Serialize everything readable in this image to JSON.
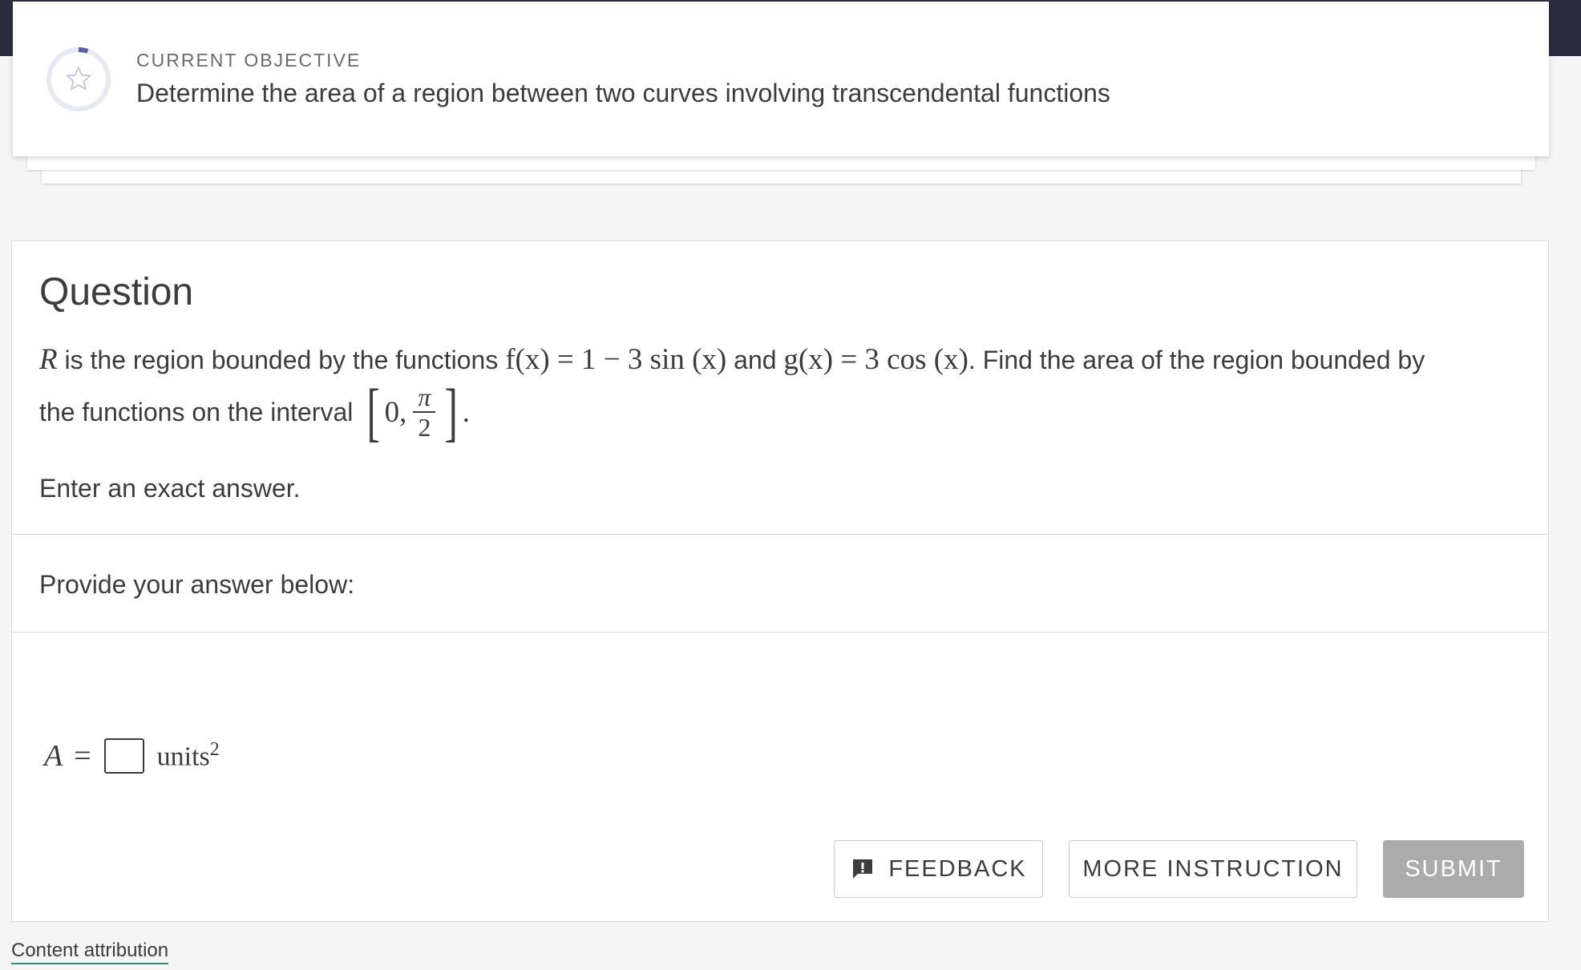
{
  "objective": {
    "label": "CURRENT OBJECTIVE",
    "text": "Determine the area of a region between two curves involving transcendental functions",
    "icon": "star-icon",
    "progress_fraction": 0.05
  },
  "question": {
    "title": "Question",
    "prompt": {
      "region_var": "R",
      "text_a": " is the region bounded by the functions ",
      "f_expr": "f(x) = 1 − 3 sin (x)",
      "text_and": " and ",
      "g_expr": "g(x) = 3 cos (x)",
      "text_b": ". Find the area of the region bounded by",
      "line2_text": "the functions on the interval",
      "interval_open": "[",
      "interval_start": "0,",
      "interval_num": "π",
      "interval_den": "2",
      "interval_close": "]",
      "period": "."
    },
    "instruction": "Enter an exact answer."
  },
  "answer": {
    "section_label": "Provide your answer below:",
    "var": "A",
    "equals": "=",
    "value": "",
    "units": "units",
    "units_power": "2"
  },
  "buttons": {
    "feedback": "FEEDBACK",
    "more_instruction": "MORE INSTRUCTION",
    "submit": "SUBMIT"
  },
  "footer": {
    "attribution": "Content attribution"
  },
  "colors": {
    "topbar": "#2b2d3e",
    "progress_accent": "#5a63a8",
    "submit_disabled": "#ababab",
    "link_underline": "#2e8b7a"
  }
}
